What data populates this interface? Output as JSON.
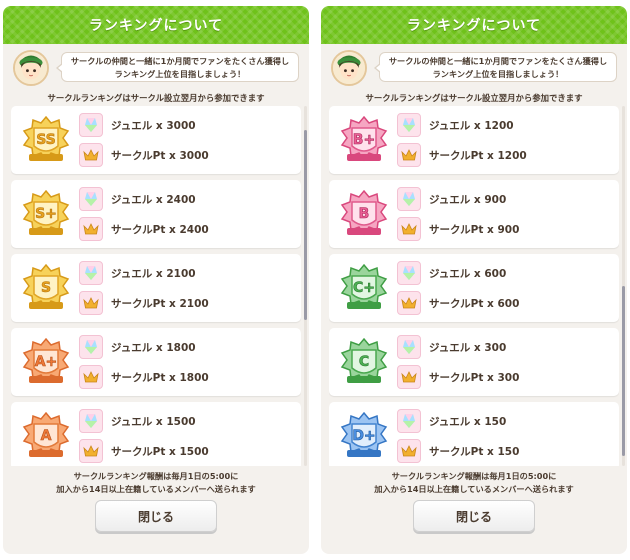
{
  "panels": [
    {
      "title": "ランキングについて",
      "intro_line1": "サークルの仲間と一緒に1か月間でファンをたくさん獲得し",
      "intro_line2": "ランキング上位を目指しましょう！",
      "notice": "サークルランキングはサークル設立翌月から参加できます",
      "rows": [
        {
          "rank": "SS",
          "jewel": "ジュエル x 3000",
          "points": "サークルPt x 3000"
        },
        {
          "rank": "S+",
          "jewel": "ジュエル x 2400",
          "points": "サークルPt x 2400"
        },
        {
          "rank": "S",
          "jewel": "ジュエル x 2100",
          "points": "サークルPt x 2100"
        },
        {
          "rank": "A+",
          "jewel": "ジュエル x 1800",
          "points": "サークルPt x 1800"
        },
        {
          "rank": "A",
          "jewel": "ジュエル x 1500",
          "points": "サークルPt x 1500"
        }
      ],
      "footer_line1": "サークルランキング報酬は毎月1日の5:00に",
      "footer_line2": "加入から14日以上在籍しているメンバーへ送られます",
      "close_label": "閉じる"
    },
    {
      "title": "ランキングについて",
      "intro_line1": "サークルの仲間と一緒に1か月間でファンをたくさん獲得し",
      "intro_line2": "ランキング上位を目指しましょう！",
      "notice": "サークルランキングはサークル設立翌月から参加できます",
      "rows": [
        {
          "rank": "B+",
          "jewel": "ジュエル x 1200",
          "points": "サークルPt x 1200"
        },
        {
          "rank": "B",
          "jewel": "ジュエル x 900",
          "points": "サークルPt x 900"
        },
        {
          "rank": "C+",
          "jewel": "ジュエル x 600",
          "points": "サークルPt x 600"
        },
        {
          "rank": "C",
          "jewel": "ジュエル x 300",
          "points": "サークルPt x 300"
        },
        {
          "rank": "D+",
          "jewel": "ジュエル x 150",
          "points": "サークルPt x 150"
        }
      ],
      "footer_line1": "サークルランキング報酬は毎月1日の5:00に",
      "footer_line2": "加入から14日以上在籍しているメンバーへ送られます",
      "close_label": "閉じる"
    }
  ],
  "icons": {
    "jewel": "jewel-icon",
    "points": "crown-icon",
    "avatar": "character-avatar"
  },
  "colors": {
    "title_bar": "#6fc21a",
    "panel_bg": "#f4f1ed",
    "text": "#4a3b2f",
    "gold_badge": "#f2b631",
    "orange_badge": "#f08a4b",
    "pink_badge": "#ec6c9b",
    "green_badge": "#58b85c",
    "blue_badge": "#4c8fe0"
  }
}
